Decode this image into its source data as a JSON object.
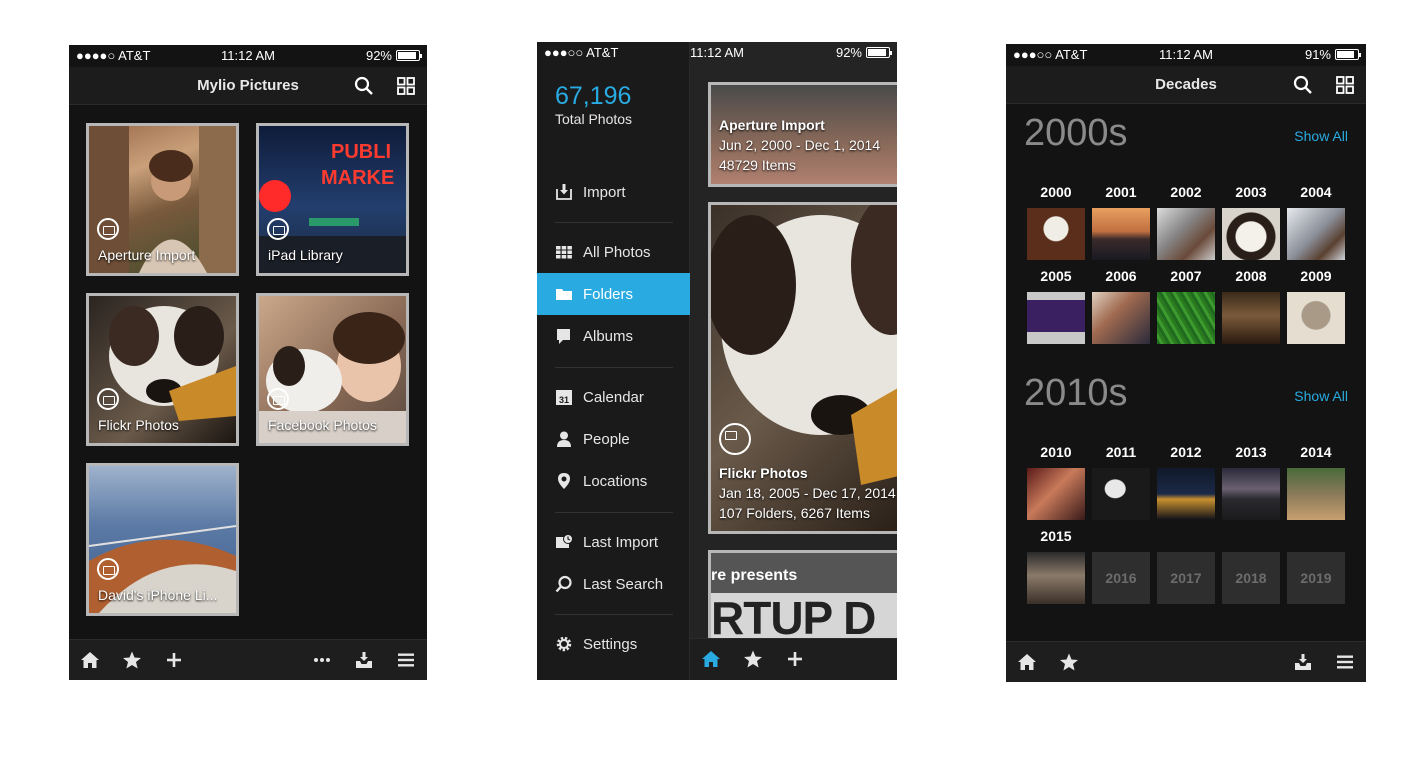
{
  "screens": {
    "folders": {
      "status": {
        "carrier": "●●●●○ AT&T",
        "time": "11:12 AM",
        "battery": "92%"
      },
      "title": "Mylio Pictures",
      "tiles": [
        {
          "label": "Aperture Import"
        },
        {
          "label": "iPad Library"
        },
        {
          "label": "Flickr Photos"
        },
        {
          "label": "Facebook Photos"
        },
        {
          "label": "David's iPhone Li..."
        }
      ],
      "icons": {
        "search": "search-icon",
        "grid": "grid-icon",
        "home": "home-icon",
        "star": "star-icon",
        "add": "plus-icon",
        "more": "more-icon",
        "import": "import-tray-icon",
        "menu": "menu-icon"
      }
    },
    "sidebar": {
      "status": {
        "carrier": "●●●○○ AT&T",
        "time": "11:12 AM",
        "battery": "92%"
      },
      "total_count": "67,196",
      "total_label": "Total Photos",
      "items": [
        {
          "label": "Import",
          "icon": "import-icon"
        },
        {
          "label": "All Photos",
          "icon": "grid-icon"
        },
        {
          "label": "Folders",
          "icon": "folder-icon",
          "active": true
        },
        {
          "label": "Albums",
          "icon": "album-icon"
        },
        {
          "label": "Calendar",
          "icon": "calendar-icon"
        },
        {
          "label": "People",
          "icon": "person-icon"
        },
        {
          "label": "Locations",
          "icon": "location-pin-icon"
        },
        {
          "label": "Last Import",
          "icon": "last-import-icon"
        },
        {
          "label": "Last Search",
          "icon": "search-icon"
        },
        {
          "label": "Settings",
          "icon": "gear-icon"
        }
      ],
      "calendar_day": "31",
      "cards": [
        {
          "title": "Aperture Import",
          "dates": "Jun 2, 2000 - Dec 1, 2014",
          "count": "48729 Items"
        },
        {
          "title": "Flickr Photos",
          "dates": "Jan 18, 2005 - Dec 17, 2014",
          "count": "107 Folders, 6267 Items"
        },
        {
          "title": "",
          "dates": "",
          "count": "",
          "poster_text_1": "re presents",
          "poster_text_2": "RTUP D"
        }
      ],
      "accent": "#29abe2"
    },
    "decades": {
      "status": {
        "carrier": "●●●○○ AT&T",
        "time": "11:12 AM",
        "battery": "91%"
      },
      "title": "Decades",
      "show_all": "Show All",
      "groups": [
        {
          "decade": "2000s",
          "years": [
            "2000",
            "2001",
            "2002",
            "2003",
            "2004",
            "2005",
            "2006",
            "2007",
            "2008",
            "2009"
          ]
        },
        {
          "decade": "2010s",
          "years": [
            "2010",
            "2011",
            "2012",
            "2013",
            "2014",
            "2015"
          ],
          "empty_years": [
            "2016",
            "2017",
            "2018",
            "2019"
          ]
        }
      ]
    }
  }
}
